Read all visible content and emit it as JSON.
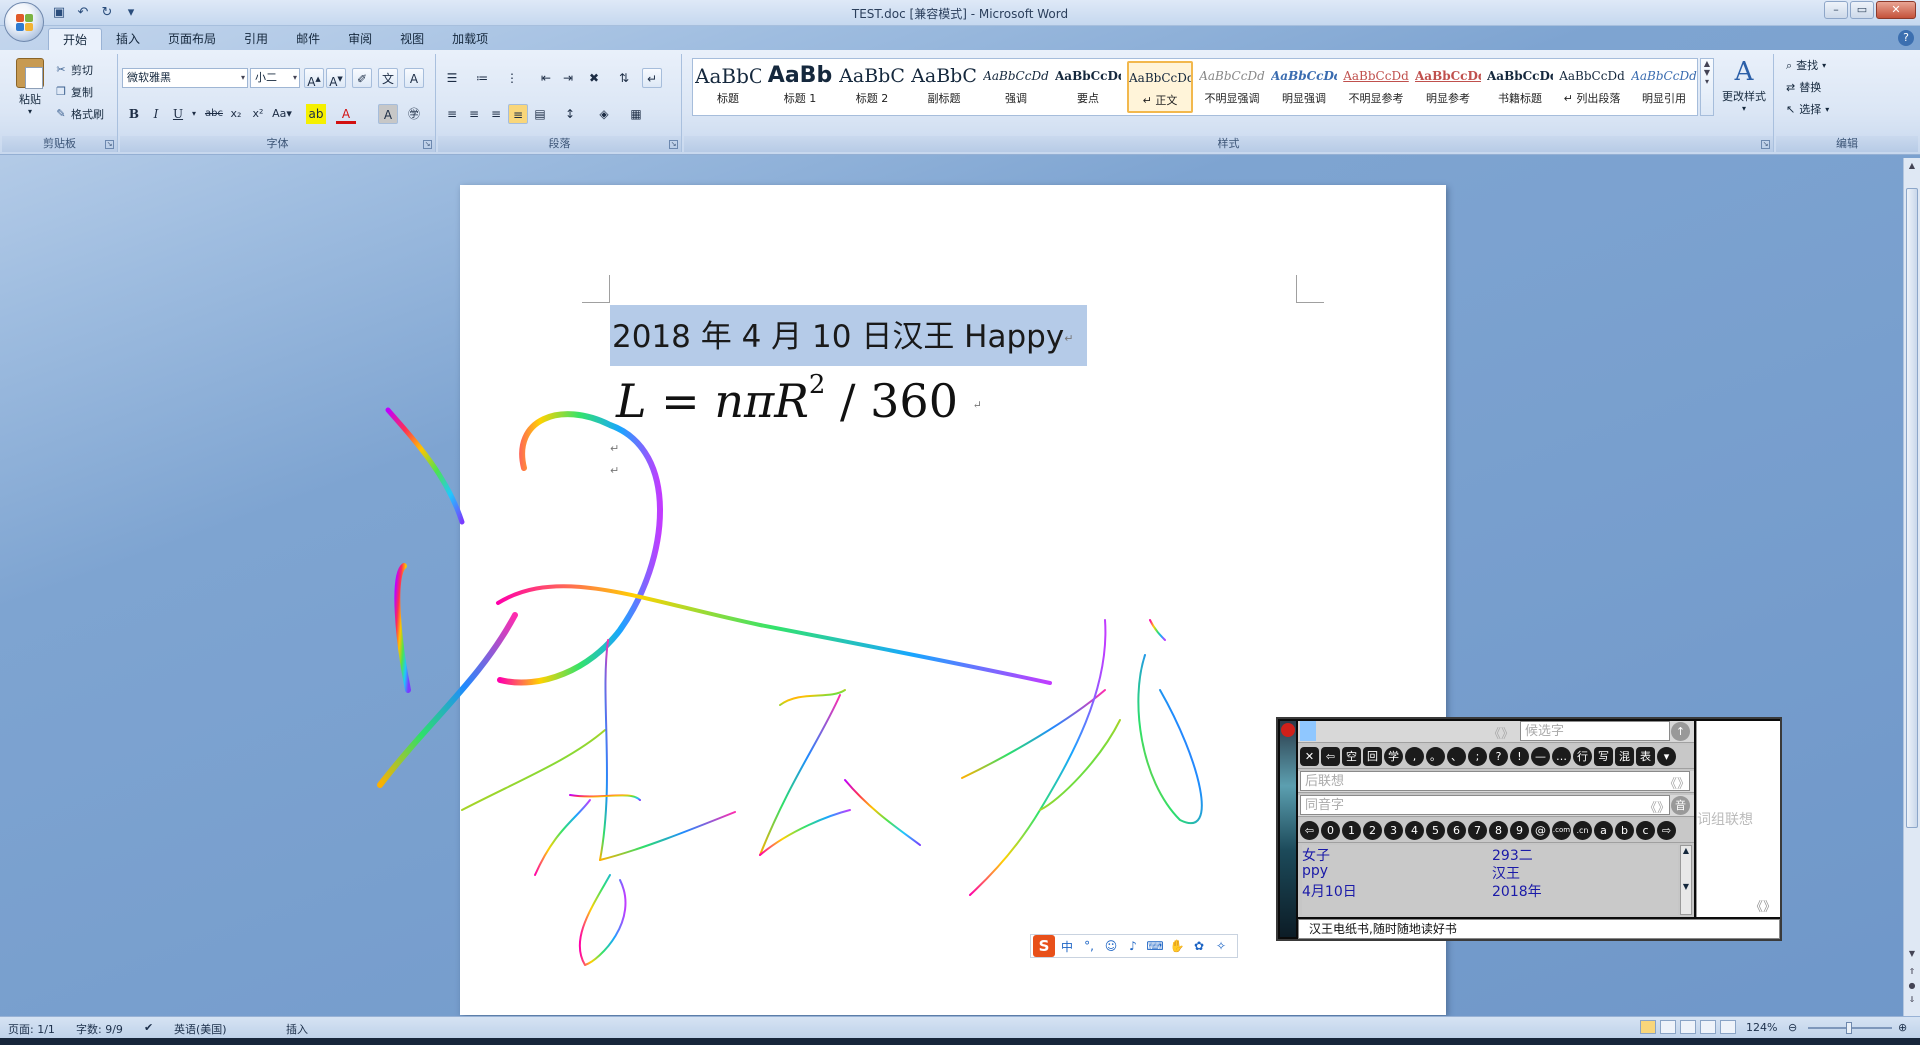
{
  "window": {
    "title": "TEST.doc [兼容模式] - Microsoft Word"
  },
  "qat": {
    "save_icon": "save-icon",
    "undo_icon": "undo-icon",
    "redo_icon": "redo-icon"
  },
  "tabs": [
    {
      "label": "开始"
    },
    {
      "label": "插入"
    },
    {
      "label": "页面布局"
    },
    {
      "label": "引用"
    },
    {
      "label": "邮件"
    },
    {
      "label": "审阅"
    },
    {
      "label": "视图"
    },
    {
      "label": "加载项"
    }
  ],
  "clipboard": {
    "group_label": "剪贴板",
    "paste": "粘贴",
    "cut": "剪切",
    "copy": "复制",
    "format_painter": "格式刷"
  },
  "font": {
    "group_label": "字体",
    "family": "微软雅黑",
    "size": "小二"
  },
  "paragraph": {
    "group_label": "段落"
  },
  "styles": {
    "group_label": "样式",
    "items": [
      {
        "sample": "AaBbC",
        "name": "标题"
      },
      {
        "sample": "AaBb",
        "name": "标题 1"
      },
      {
        "sample": "AaBbC",
        "name": "标题 2"
      },
      {
        "sample": "AaBbC",
        "name": "副标题"
      },
      {
        "sample": "AaBbCcDd",
        "name": "强调"
      },
      {
        "sample": "AaBbCcDd",
        "name": "要点"
      },
      {
        "sample": "AaBbCcDd",
        "name": "↵ 正文"
      },
      {
        "sample": "AaBbCcDd",
        "name": "不明显强调"
      },
      {
        "sample": "AaBbCcDd",
        "name": "明显强调"
      },
      {
        "sample": "AaBbCcDd",
        "name": "不明显参考"
      },
      {
        "sample": "AaBbCcDd",
        "name": "明显参考"
      },
      {
        "sample": "AaBbCcDd",
        "name": "书籍标题"
      },
      {
        "sample": "AaBbCcDd",
        "name": "↵ 列出段落"
      },
      {
        "sample": "AaBbCcDd",
        "name": "明显引用"
      }
    ],
    "change_styles": "更改样式"
  },
  "editing": {
    "group_label": "编辑",
    "find": "查找",
    "replace": "替换",
    "select": "选择"
  },
  "document": {
    "line1": "2018 年 4 月 10 日汉王 Happy",
    "formula": {
      "lhs": "L",
      "eq": "=",
      "n": "n",
      "pi": "π",
      "R": "R",
      "exp": "2",
      "div": "/",
      "num": "360"
    }
  },
  "sogou": {
    "logo": "S",
    "mode": "中"
  },
  "ime": {
    "candidate_placeholder": "候选字",
    "chev": "《》",
    "assoc_placeholder": "后联想",
    "homophone_placeholder": "同音字",
    "phrase_assoc": "词组联想",
    "symbols": [
      "✕",
      "⇦",
      "空",
      "回",
      "学",
      ",",
      "。",
      "、",
      ";",
      "?",
      "!",
      "—",
      "…",
      "行",
      "写",
      "混",
      "表"
    ],
    "digits": [
      "⇦",
      "0",
      "1",
      "2",
      "3",
      "4",
      "5",
      "6",
      "7",
      "8",
      "9",
      "@",
      ".com",
      ".cn",
      "a",
      "b",
      "c",
      "⇨"
    ],
    "candidates": [
      {
        "text": "女子"
      },
      {
        "text": "293二"
      },
      {
        "text": "ppy"
      },
      {
        "text": "汉王"
      },
      {
        "text": "4月10日"
      },
      {
        "text": "2018年"
      }
    ],
    "status": "汉王电纸书,随时随地读好书"
  },
  "statusbar": {
    "page": "页面: 1/1",
    "words": "字数: 9/9",
    "language": "英语(美国)",
    "mode": "插入",
    "zoom": "124%"
  }
}
